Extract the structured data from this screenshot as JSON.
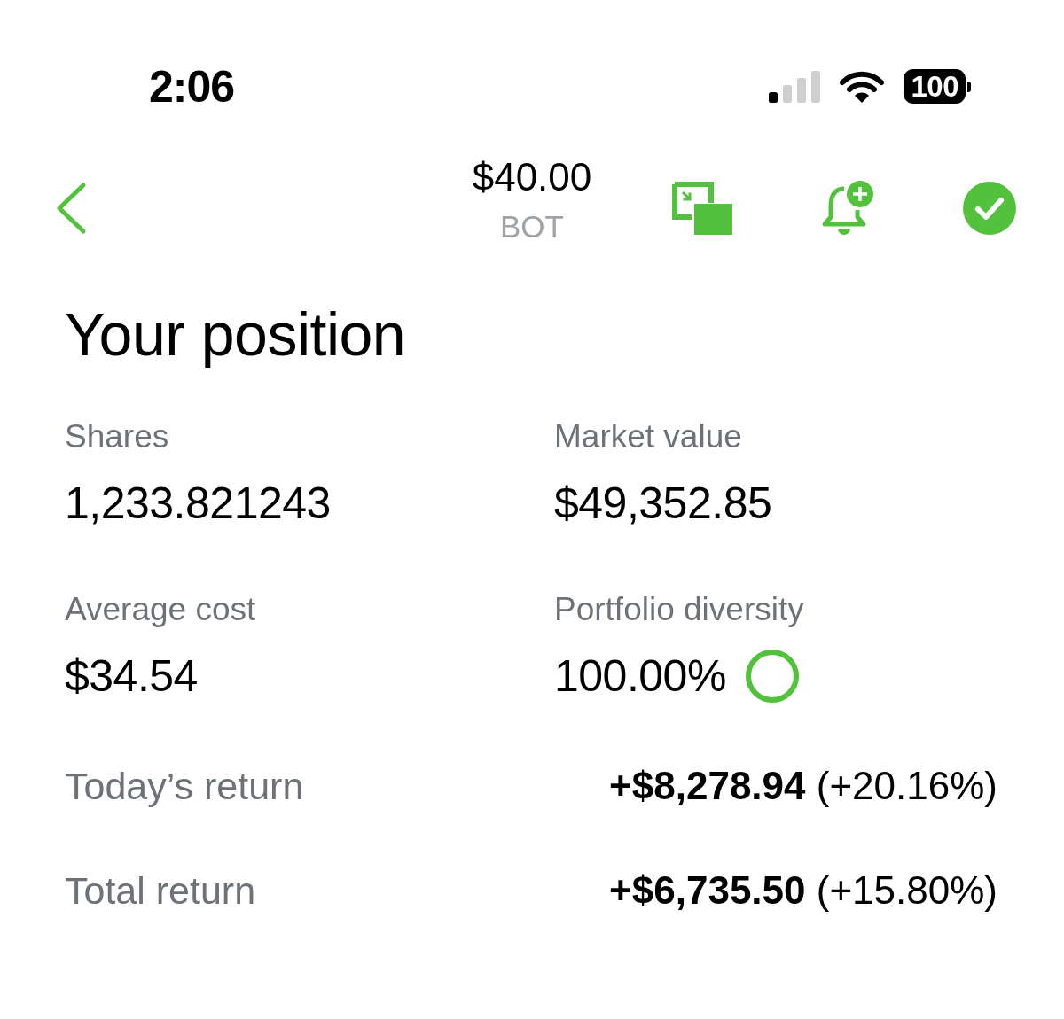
{
  "status_bar": {
    "time": "2:06",
    "battery": "100"
  },
  "header": {
    "price": "$40.00",
    "ticker": "BOT"
  },
  "position": {
    "title": "Your position",
    "stats": [
      {
        "kind": "text",
        "label": "Shares",
        "value": "1,233.821243"
      },
      {
        "kind": "text",
        "label": "Market value",
        "value": "$49,352.85"
      },
      {
        "kind": "text",
        "label": "Average cost",
        "value": "$34.54"
      },
      {
        "kind": "ring",
        "label": "Portfolio diversity",
        "value": "100.00%",
        "level": 1
      }
    ],
    "returns": [
      {
        "label": "Today’s return",
        "value": "**+$8,278.94** (+20.16%)"
      },
      {
        "label": "Total return",
        "value": "**+$6,735.50** (+15.80%)"
      }
    ]
  }
}
